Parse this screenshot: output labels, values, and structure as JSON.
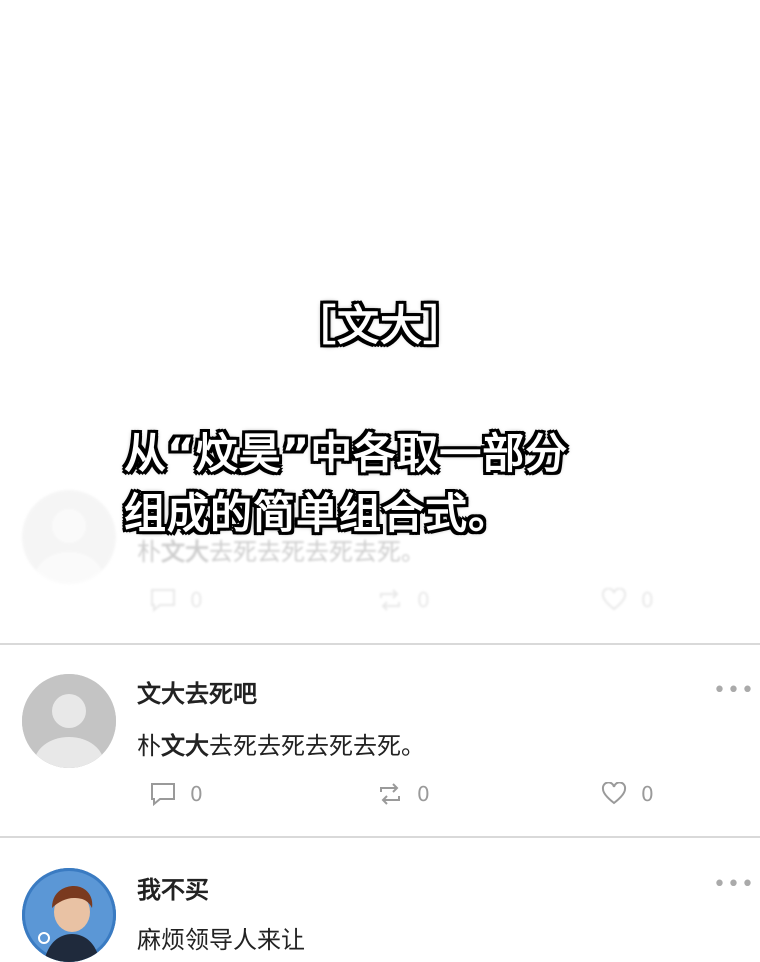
{
  "captions": {
    "name": "［文大］",
    "line1": "从“炆昊”中各取一部分",
    "line2": "组成的简单组合式。"
  },
  "posts": [
    {
      "username": "",
      "content_pre": "朴",
      "content_bold": "文大",
      "content_post": "去死去死去死去死。",
      "comments": "0",
      "reposts": "0",
      "likes": "0"
    },
    {
      "username": "文大去死吧",
      "content_pre": "朴",
      "content_bold": "文大",
      "content_post": "去死去死去死去死。",
      "comments": "0",
      "reposts": "0",
      "likes": "0",
      "more": "•••"
    },
    {
      "username": "我不买",
      "content_pre": "麻烦领导人来让",
      "content_bold": "",
      "content_post": "",
      "more": "•••"
    }
  ],
  "icons": [
    "comment-icon",
    "repost-icon",
    "heart-icon",
    "more-icon",
    "default-avatar-icon"
  ]
}
